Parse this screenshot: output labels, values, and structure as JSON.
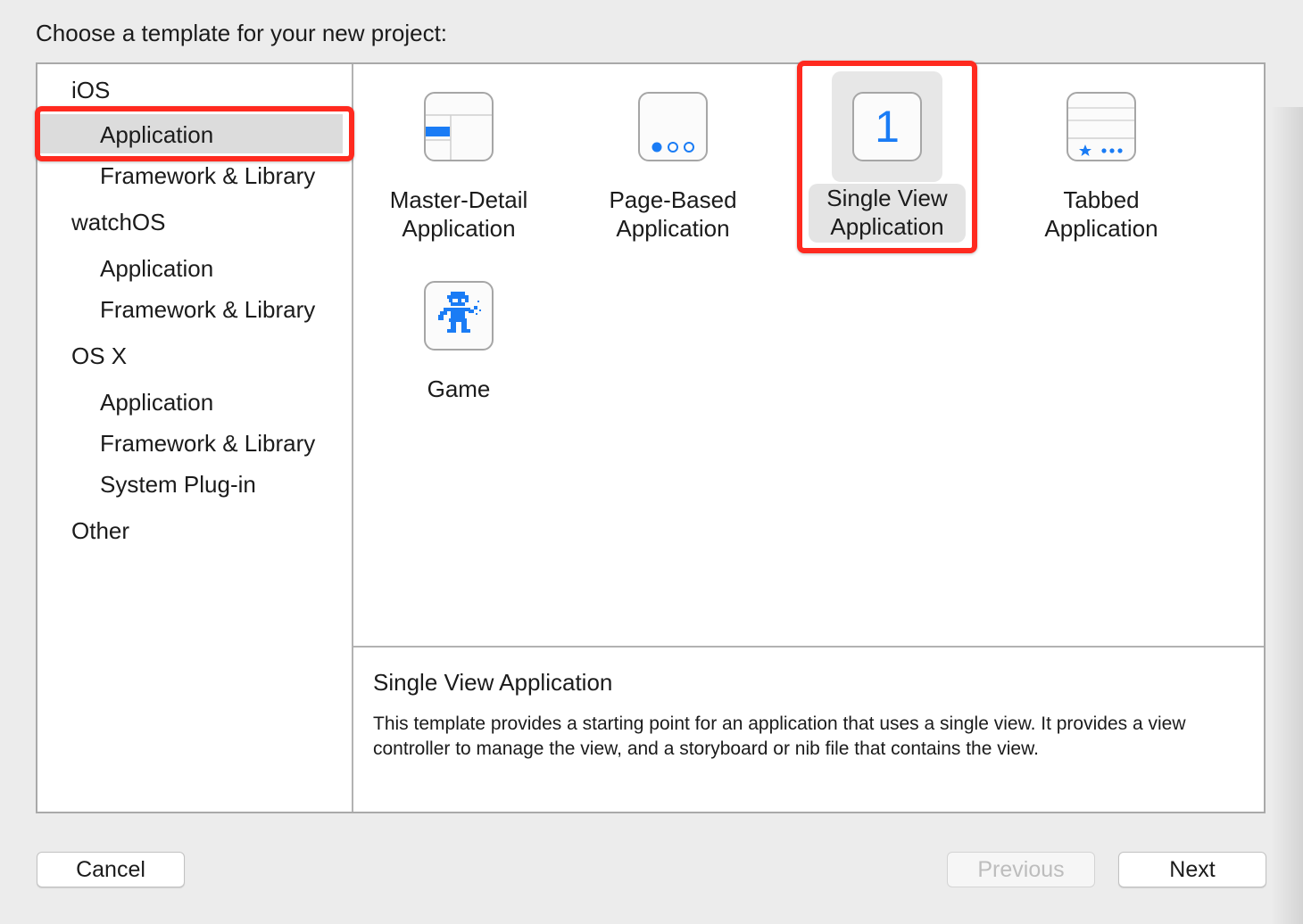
{
  "prompt": "Choose a template for your new project:",
  "sidebar": {
    "sections": [
      {
        "heading": "iOS",
        "items": [
          "Application",
          "Framework & Library"
        ]
      },
      {
        "heading": "watchOS",
        "items": [
          "Application",
          "Framework & Library"
        ]
      },
      {
        "heading": "OS X",
        "items": [
          "Application",
          "Framework & Library",
          "System Plug-in"
        ]
      },
      {
        "heading": "Other",
        "items": []
      }
    ],
    "selected": "iOS / Application"
  },
  "templates": [
    {
      "line1": "Master-Detail",
      "line2": "Application",
      "icon": "master-detail-icon"
    },
    {
      "line1": "Page-Based",
      "line2": "Application",
      "icon": "page-dots-icon"
    },
    {
      "line1": "Single View",
      "line2": "Application",
      "icon": "single-view-icon",
      "glyph": "1",
      "selected": true
    },
    {
      "line1": "Tabbed",
      "line2": "Application",
      "icon": "tab-bar-icon"
    },
    {
      "line1": "Game",
      "line2": "",
      "icon": "game-robot-icon"
    }
  ],
  "description": {
    "title": "Single View Application",
    "body": "This template provides a starting point for an application that uses a single view. It provides a view controller to manage the view, and a storyboard or nib file that contains the view."
  },
  "buttons": {
    "cancel": "Cancel",
    "previous": "Previous",
    "next": "Next"
  },
  "colors": {
    "accent_blue": "#1a7cf5",
    "highlight_red": "#ff2a1f"
  }
}
